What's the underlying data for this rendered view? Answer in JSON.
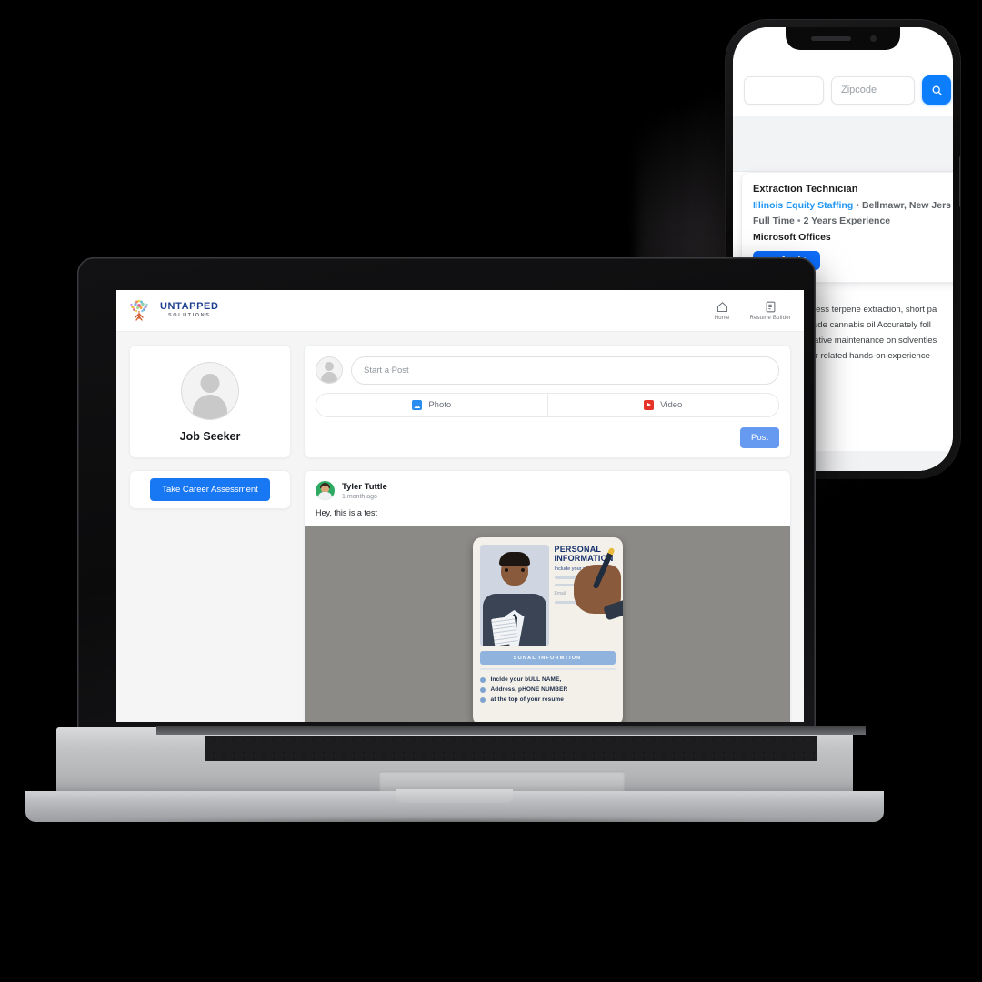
{
  "laptop": {
    "header": {
      "brand_name": "UNTAPPED",
      "brand_sub": "SOLUTIONS",
      "logo_icon": "tree-logo-icon",
      "nav": [
        {
          "label": "Home",
          "icon": "home-icon"
        },
        {
          "label": "Resume Builder",
          "icon": "document-icon"
        }
      ]
    },
    "sidebar": {
      "profile_name": "Job Seeker",
      "avatar_icon": "user-avatar-icon",
      "assessment_button": "Take Career Assessment"
    },
    "composer": {
      "avatar_icon": "user-avatar-icon",
      "placeholder": "Start a Post",
      "photo_label": "Photo",
      "photo_icon": "image-icon",
      "video_label": "Video",
      "video_icon": "video-play-icon",
      "post_button": "Post"
    },
    "feed": {
      "author": "Tyler Tuttle",
      "timestamp": "1 month ago",
      "body": "Hey, this is a test",
      "image": {
        "title_line1": "PERSONAL",
        "title_line2": "INFORMATION",
        "subtitle": "Include your name",
        "email_label": "Email",
        "band_text": "SONAL INFORMTION",
        "bullets": [
          "Inclde your bULL NAME,",
          "Address, pHONE NUMBER",
          "at the top of your resume"
        ]
      }
    }
  },
  "phone": {
    "search": {
      "keyword_placeholder": "",
      "zipcode_placeholder": "Zipcode",
      "search_icon": "search-icon"
    },
    "job": {
      "title": "Extraction Technician",
      "company": "Illinois Equity Staffing",
      "separator": "•",
      "location": "Bellmawr, New Jers",
      "employment_type": "Full Time",
      "experience": "2 Years Experience",
      "skill": "Microsoft Offices",
      "apply_label": "Apply",
      "apply_icon": "send-icon",
      "description_lines": [
        "Operate solventless terpene extraction, short pa",
        "refinement of crude cannabis oil Accurately foll",
        "perform preventative maintenance on solventles",
        "laboratory and/or related hands-on experience"
      ]
    }
  },
  "colors": {
    "primary_blue": "#1877f2",
    "phone_blue": "#0d7efb",
    "link_blue": "#2196f3",
    "post_blue": "#6699f0",
    "photo_icon": "#2a8ef0",
    "video_icon": "#e5332a",
    "page_bg": "#f5f5f5"
  }
}
